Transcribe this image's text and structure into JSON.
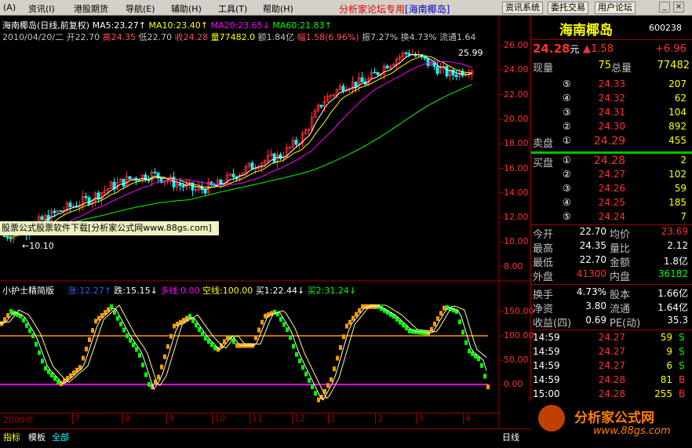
{
  "menu": [
    "(A)",
    "资讯(I)",
    "港股期货",
    "导航(E)",
    "辅助(H)",
    "工具(T)",
    "帮助(H)"
  ],
  "hot_text": "分析家论坛专用",
  "hot_tag": "[海南椰岛]",
  "toolbar": [
    "资讯系统",
    "委托交易",
    "用户论坛"
  ],
  "window": {
    "min": "_",
    "close": "×"
  },
  "chart": {
    "header1": {
      "title": "海南椰岛(日线,前复权)",
      "ma5": "MA5:23.27↑",
      "ma10": "MA10:23.40↑",
      "ma20": "MA20:23.65↓",
      "ma60": "MA60:21.83↑"
    },
    "header2": {
      "date": "2010/04/20/二",
      "open": "开22.70",
      "high": "高24.35",
      "low": "低22.70",
      "close": "收24.28",
      "vol": "量77482.0",
      "amt": "额1.84亿",
      "chg": "幅1.58(6.96%)",
      "amp": "振7.27%",
      "turn": "换4.73%",
      "float": "流通1.64"
    },
    "peak_label": "25.99",
    "low_label": "←10.10",
    "banner": "股票公式股票软件下载[分析家公式网www.88gs.com]",
    "price_ticks": [
      "26.00",
      "24.00",
      "22.00",
      "20.00",
      "18.00",
      "16.00",
      "14.00",
      "12.00",
      "10.00",
      "8.00"
    ],
    "ind_header": {
      "name": "小护士精简版",
      "a": "涨:12.27↑",
      "b": "跌:15.15↓",
      "c": "多线:0.00",
      "d": "空线:100.00",
      "e": "买1:22.44↓",
      "f": "买2:31.24↓"
    },
    "ind_ticks": [
      "150.00",
      "100.00",
      "50.00",
      "0.00"
    ],
    "dates": [
      "2009年",
      "7",
      "8",
      "9",
      "10",
      "11",
      "12",
      "1",
      "2",
      "3",
      "4"
    ],
    "period": "日线"
  },
  "bottom_tabs": [
    "指标",
    "模板",
    "全部"
  ],
  "quote": {
    "name": "海南椰岛",
    "code": "600238",
    "price": "24.28",
    "price_unit": "元",
    "chg": "▲1.58",
    "chg_pct": "+6.96",
    "now_vol_label": "现量",
    "now_vol": "75",
    "tot_vol_label": "总量",
    "tot_vol": "77482",
    "sell_label": "卖盘",
    "buy_label": "买盘",
    "sells": [
      {
        "lvl": "⑤",
        "price": "24.33",
        "vol": "207"
      },
      {
        "lvl": "④",
        "price": "24.32",
        "vol": "62"
      },
      {
        "lvl": "③",
        "price": "24.31",
        "vol": "104"
      },
      {
        "lvl": "②",
        "price": "24.30",
        "vol": "892"
      },
      {
        "lvl": "①",
        "price": "24.29",
        "vol": "455"
      }
    ],
    "buys": [
      {
        "lvl": "①",
        "price": "24.28",
        "vol": "2"
      },
      {
        "lvl": "②",
        "price": "24.27",
        "vol": "102"
      },
      {
        "lvl": "③",
        "price": "24.26",
        "vol": "59"
      },
      {
        "lvl": "④",
        "price": "24.25",
        "vol": "185"
      },
      {
        "lvl": "⑤",
        "price": "24.24",
        "vol": "7"
      }
    ],
    "stats": [
      {
        "l1": "今开",
        "v1": "22.70",
        "l2": "均价",
        "v2": "23.69"
      },
      {
        "l1": "最高",
        "v1": "24.35",
        "l2": "量比",
        "v2": "2.12"
      },
      {
        "l1": "最低",
        "v1": "22.70",
        "l2": "金额",
        "v2": "1.8亿"
      },
      {
        "l1": "外盘",
        "v1": "41300",
        "l2": "内盘",
        "v2": "36182"
      }
    ],
    "fund": [
      {
        "l1": "换手",
        "v1": "4.73%",
        "l2": "股本",
        "v2": "1.66亿"
      },
      {
        "l1": "净资",
        "v1": "3.80",
        "l2": "流通",
        "v2": "1.64亿"
      },
      {
        "l1": "收益(四)",
        "v1": "0.69",
        "l2": "PE(动)",
        "v2": "35.3"
      }
    ],
    "ticks": [
      {
        "t": "14:59",
        "p": "24.27",
        "v": "59",
        "s": "S"
      },
      {
        "t": "14:59",
        "p": "24.27",
        "v": "9",
        "s": "S"
      },
      {
        "t": "14:59",
        "p": "24.27",
        "v": "6",
        "s": "S"
      },
      {
        "t": "14:59",
        "p": "24.28",
        "v": "81",
        "s": "B"
      },
      {
        "t": "15:00",
        "p": "24.28",
        "v": "255",
        "s": "B"
      }
    ]
  },
  "watermark": {
    "text": "分析家公式网",
    "url": "www.88gs.com"
  }
}
